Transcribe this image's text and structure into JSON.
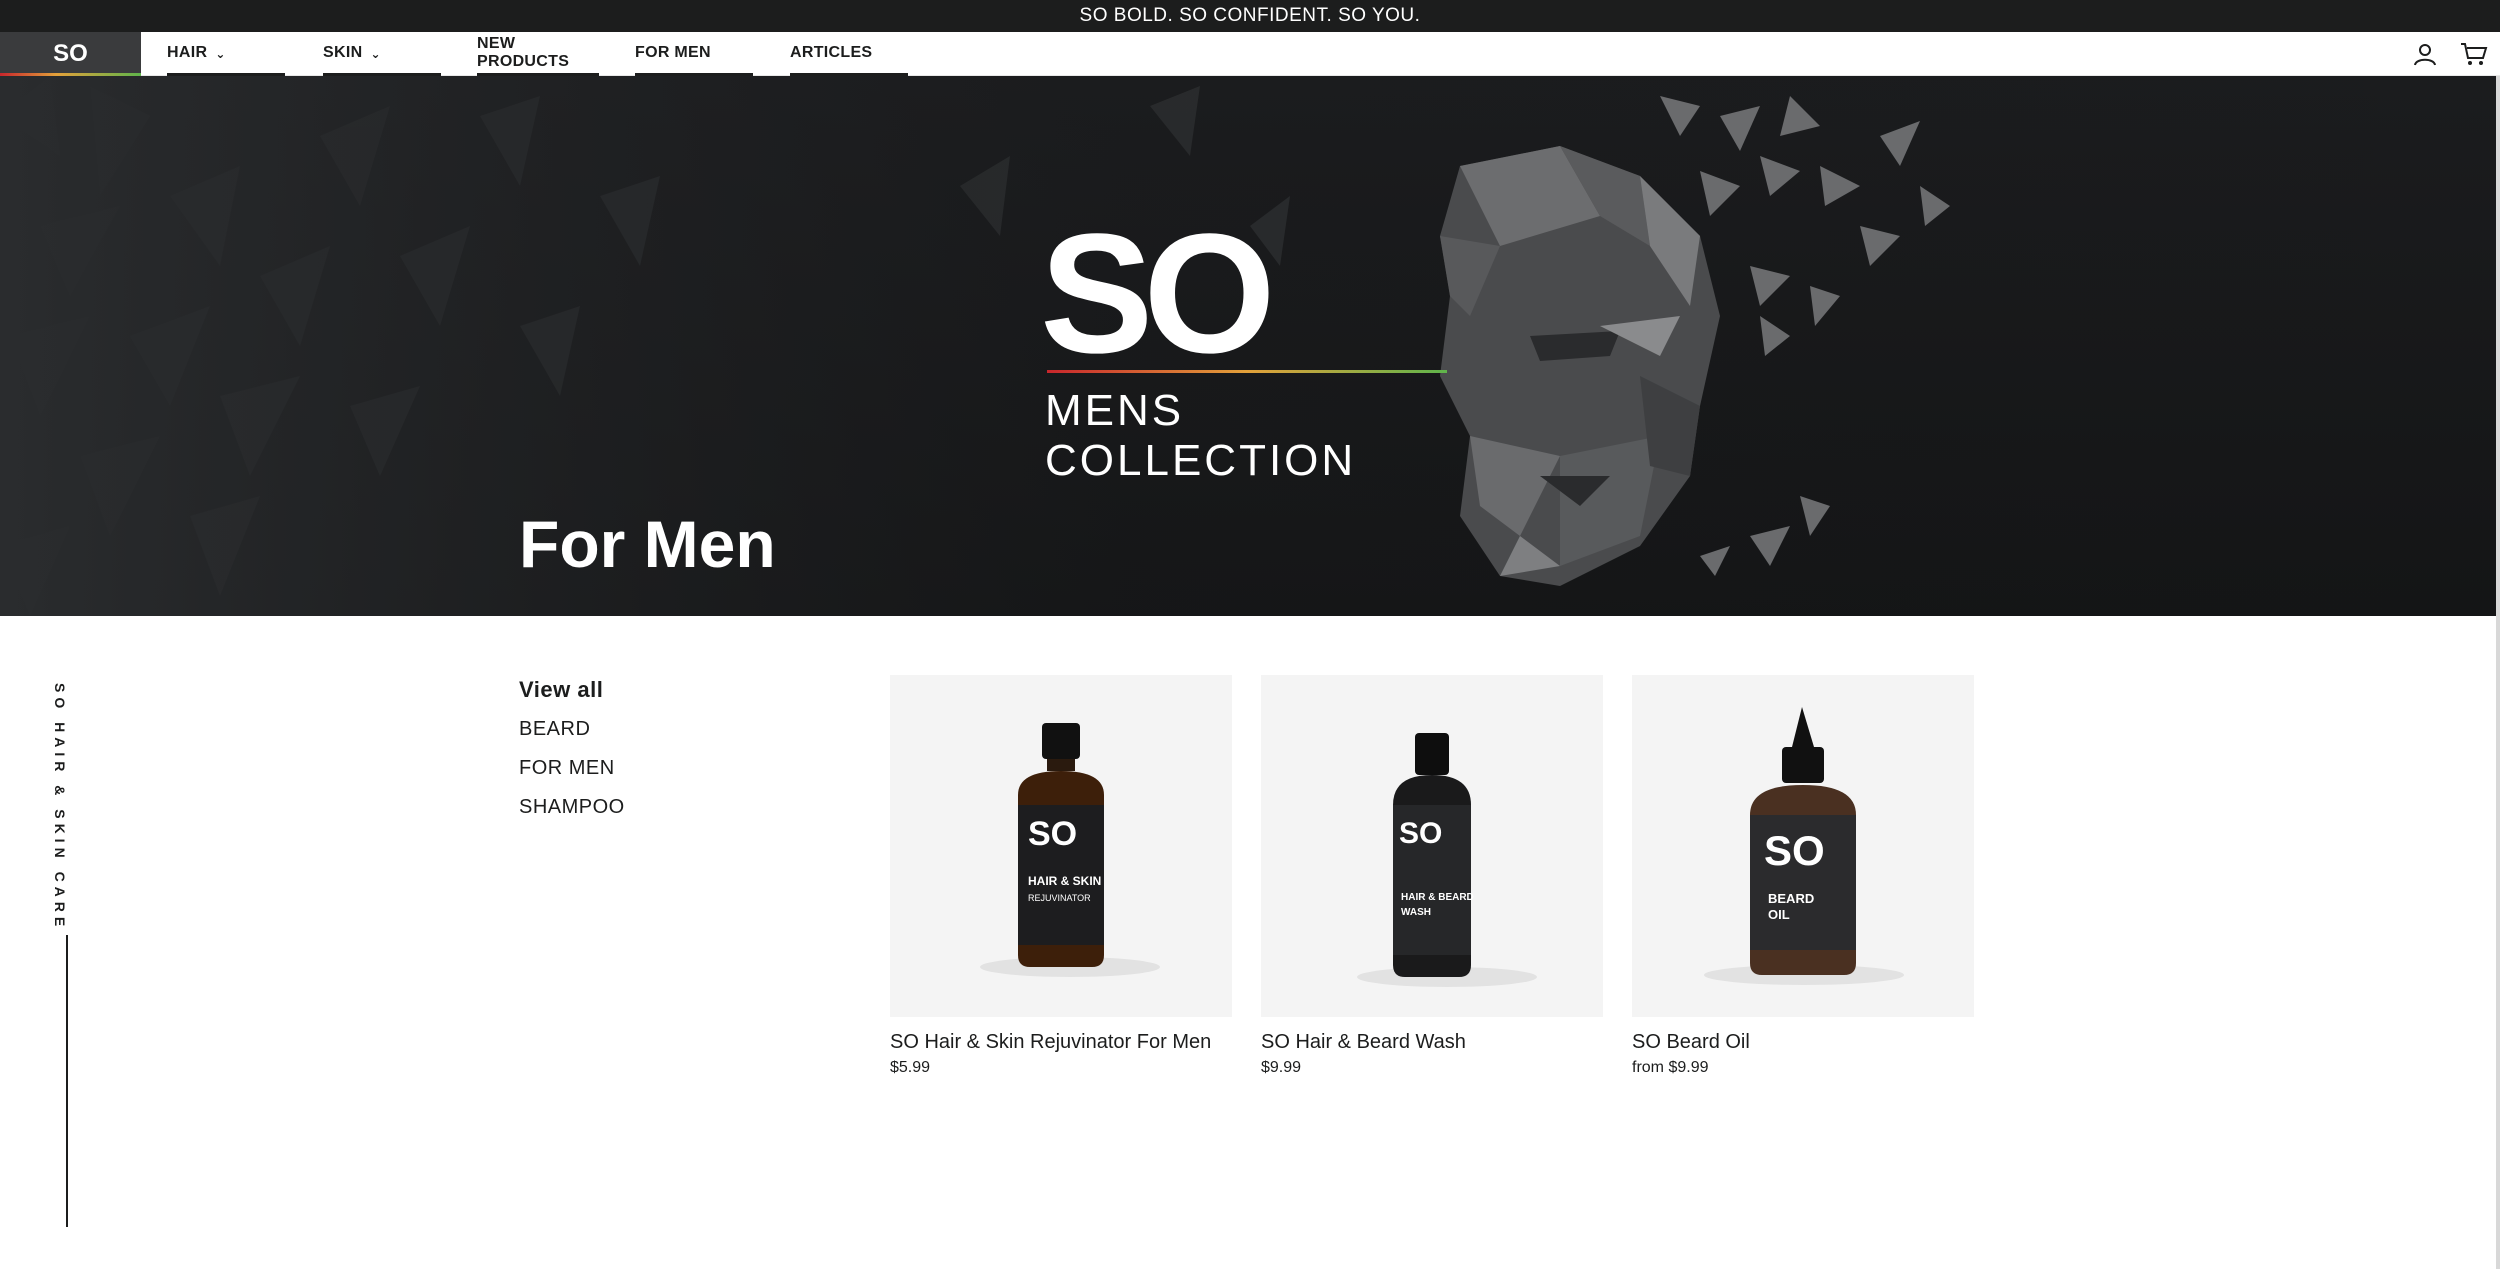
{
  "announcement": "SO BOLD. SO CONFIDENT. SO YOU.",
  "header": {
    "logo": "SO",
    "nav": [
      {
        "label": "HAIR",
        "has_dropdown": true
      },
      {
        "label": "SKIN",
        "has_dropdown": true
      },
      {
        "label": "NEW PRODUCTS",
        "has_dropdown": false
      },
      {
        "label": "FOR MEN",
        "has_dropdown": false
      },
      {
        "label": "ARTICLES",
        "has_dropdown": false
      }
    ],
    "icons": [
      "account-icon",
      "cart-icon"
    ]
  },
  "hero": {
    "brand": "SO",
    "subtitle": "MENS COLLECTION",
    "title": "For Men"
  },
  "side_label": "SO HAIR & SKIN CARE",
  "filters": [
    {
      "label": "View all",
      "active": true
    },
    {
      "label": "BEARD",
      "active": false
    },
    {
      "label": "FOR MEN",
      "active": false
    },
    {
      "label": "SHAMPOO",
      "active": false
    }
  ],
  "products": [
    {
      "name": "SO Hair & Skin Rejuvinator For Men",
      "price": "$5.99",
      "bottle_label": "HAIR & SKIN",
      "bottle_sub": "REJUVINATOR"
    },
    {
      "name": "SO Hair & Beard Wash",
      "price": "$9.99",
      "bottle_label": "HAIR & BEARD",
      "bottle_sub": "WASH"
    },
    {
      "name": "SO Beard Oil",
      "price": "from $9.99",
      "bottle_label": "BEARD",
      "bottle_sub": "OIL"
    }
  ],
  "colors": {
    "dark": "#1c1d1d",
    "accent_red": "#c8262c",
    "accent_yellow": "#e3a13a",
    "accent_green": "#5fb44b"
  }
}
